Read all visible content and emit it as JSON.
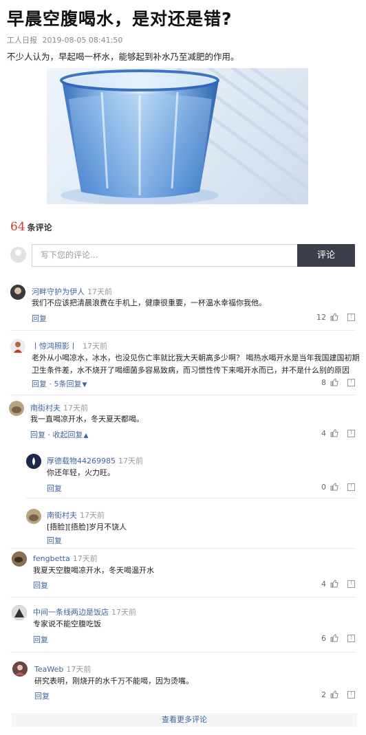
{
  "article": {
    "title": "早晨空腹喝水，是对还是错?",
    "source": "工人日报",
    "datetime": "2019-08-05 08:41:50",
    "lead": "不少人认为，早起喝一杯水，能够起到补水乃至减肥的作用。"
  },
  "comments_header": {
    "count": "64",
    "label": "条评论"
  },
  "comment_form": {
    "placeholder": "写下您的评论...",
    "submit_label": "评论"
  },
  "comments": [
    {
      "name": "河畔守护为伊人",
      "time": "17天前",
      "text": "我们不应该把清晨浪费在手机上，健康很重要，一杯温水幸福你我他。",
      "actions": "回复",
      "likes": "12"
    },
    {
      "name": "丨惊鸿照影丨",
      "time": "17天前",
      "text_line1": "老外从小喝凉水，冰水，也没见伤亡率就比我大天朝高多少啊？ 喝热水喝开水是当年我国建国初期",
      "text_line2": "卫生条件差，水不烧开了喝细菌多容易致病，而习惯性传下来喝开水而已，并不是什么别的原因",
      "reply": "回复",
      "sep": " · ",
      "replies_label": "5条回复",
      "likes": "8"
    },
    {
      "name": "南街村夫",
      "time": "17天前",
      "text": "我一直喝凉开水，冬天夏天都喝。",
      "reply": "回复",
      "sep": " · ",
      "collapse_label": "收起回复",
      "likes": "4"
    },
    {
      "name": "厚德载物44269985",
      "time": "17天前",
      "text": "你还年轻，火力旺。",
      "actions": "回复",
      "likes": "0"
    },
    {
      "name": "南街村夫",
      "time": "17天前",
      "text": "[捂脸][捂脸]岁月不饶人",
      "actions": "回复"
    },
    {
      "name": "fengbetta",
      "time": "17天前",
      "text": "我夏天空腹喝凉开水，冬天喝温开水",
      "actions": "回复",
      "likes": "4"
    },
    {
      "name": "中间一条线两边是饭店",
      "time": "17天前",
      "text": "专家说不能空腹吃饭",
      "actions": "回复",
      "likes": "6"
    },
    {
      "name": "TeaWeb",
      "time": "17天前",
      "text": "研究表明，刚烧开的水千万不能喝，因为烫嘴。",
      "actions": "回复",
      "likes": "2"
    }
  ],
  "more_comments_label": "查看更多评论",
  "icons": {
    "like": "thumbs-up-icon",
    "report": "report-icon",
    "expand": "chevron-down-icon",
    "collapse": "chevron-up-icon"
  },
  "colors": {
    "link": "#406599",
    "count": "#d33a2f",
    "button": "#3a3f4b"
  }
}
